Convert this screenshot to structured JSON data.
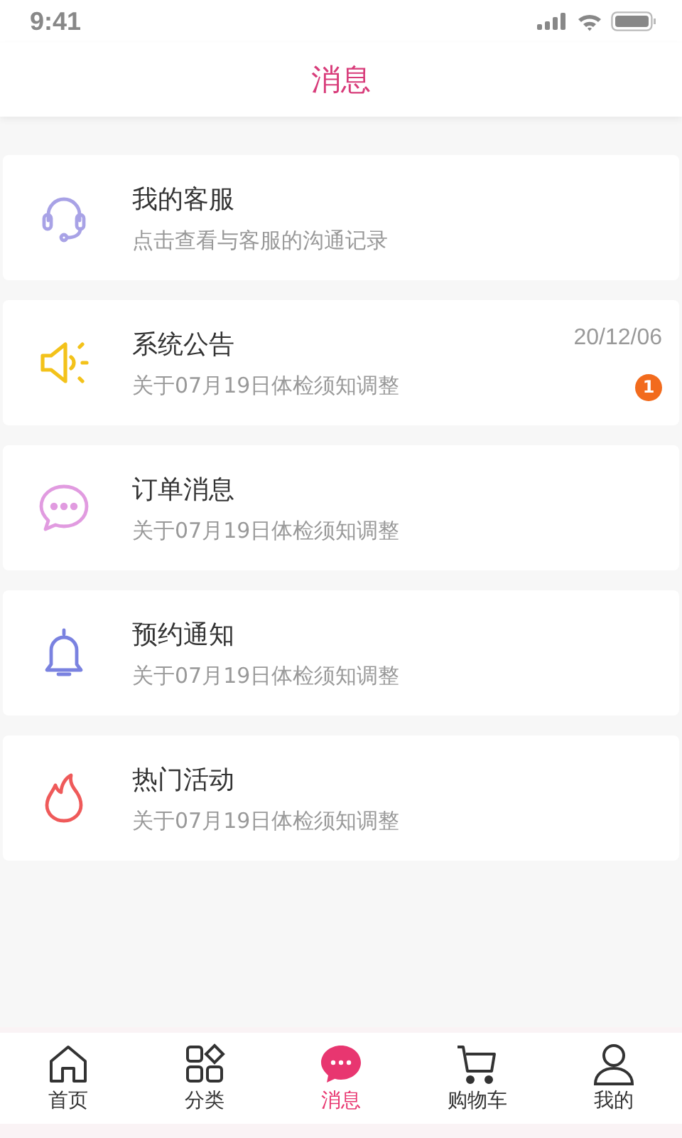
{
  "status_bar": {
    "time": "9:41"
  },
  "header": {
    "title": "消息"
  },
  "messages": [
    {
      "kind": "service",
      "title": "我的客服",
      "subtitle": "点击查看与客服的沟通记录"
    },
    {
      "kind": "notice",
      "title": "系统公告",
      "subtitle": "关于07月19日体检须知调整",
      "date": "20/12/06",
      "badge": "1"
    },
    {
      "kind": "order",
      "title": "订单消息",
      "subtitle": "关于07月19日体检须知调整"
    },
    {
      "kind": "appointment",
      "title": "预约通知",
      "subtitle": "关于07月19日体检须知调整"
    },
    {
      "kind": "activity",
      "title": "热门活动",
      "subtitle": "关于07月19日体检须知调整"
    }
  ],
  "tab_bar": [
    {
      "kind": "home",
      "label": "首页",
      "selected": false
    },
    {
      "kind": "category",
      "label": "分类",
      "selected": false
    },
    {
      "kind": "message",
      "label": "消息",
      "selected": true
    },
    {
      "kind": "cart",
      "label": "购物车",
      "selected": false
    },
    {
      "kind": "profile",
      "label": "我的",
      "selected": false
    }
  ]
}
